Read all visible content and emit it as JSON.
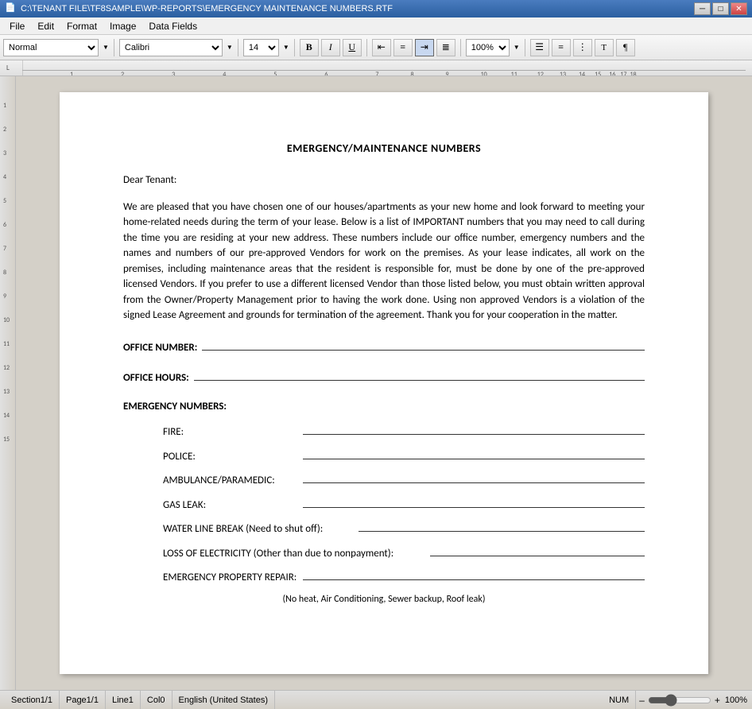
{
  "titlebar": {
    "title": "C:\\TENANT FILE\\TF8SAMPLE\\WP-REPORTS\\EMERGENCY MAINTENANCE NUMBERS.RTF",
    "minimize": "─",
    "maximize": "□",
    "close": "✕"
  },
  "menubar": {
    "items": [
      "File",
      "Edit",
      "Format",
      "Image",
      "Data Fields"
    ]
  },
  "toolbar": {
    "style": "Normal",
    "font": "Calibri",
    "size": "14",
    "bold": "B",
    "italic": "I",
    "underline": "U",
    "zoom": "100%",
    "align_left": "≡",
    "align_center": "≡",
    "align_right": "≡",
    "align_justify": "≡"
  },
  "document": {
    "title": "EMERGENCY/MAINTENANCE NUMBERS",
    "salutation": "Dear Tenant:",
    "body": "We are pleased that you have chosen one of our houses/apartments as your new home and look forward to meeting your home-related needs during the term of your lease. Below is a list of IMPORTANT numbers that you may need to call during the time you are residing at your new address. These numbers include our office number, emergency numbers and the names and numbers of our pre-approved Vendors for work on the premises.  As your lease indicates, all work on the premises, including maintenance areas that the resident is responsible for, must be done by one of the pre-approved licensed Vendors.  If you prefer to use a different licensed Vendor than those listed below, you must obtain written approval from the Owner/Property Management prior to having the work done. Using non approved Vendors is a violation of the signed Lease Agreement and grounds for termination of the agreement. Thank you for your cooperation in the matter.",
    "office_number_label": "OFFICE NUMBER:",
    "office_hours_label": "OFFICE HOURS:",
    "emergency_numbers_label": "EMERGENCY NUMBERS:",
    "fields": [
      {
        "label": "FIRE:",
        "line": ""
      },
      {
        "label": "POLICE:",
        "line": ""
      },
      {
        "label": "AMBULANCE/PARAMEDIC:",
        "line": ""
      },
      {
        "label": "GAS LEAK:",
        "line": ""
      },
      {
        "label": "WATER LINE BREAK (Need to shut off):",
        "line": ""
      },
      {
        "label": "LOSS OF ELECTRICITY (Other than  due to nonpayment):",
        "line": ""
      },
      {
        "label": "EMERGENCY PROPERTY REPAIR:",
        "line": ""
      }
    ],
    "note": "(No heat, Air Conditioning, Sewer backup, Roof leak)"
  },
  "statusbar": {
    "section": "Section1/1",
    "page": "Page1/1",
    "line": "Line1",
    "col": "Col0",
    "language": "English (United States)",
    "num": "NUM",
    "zoom": "100%"
  }
}
